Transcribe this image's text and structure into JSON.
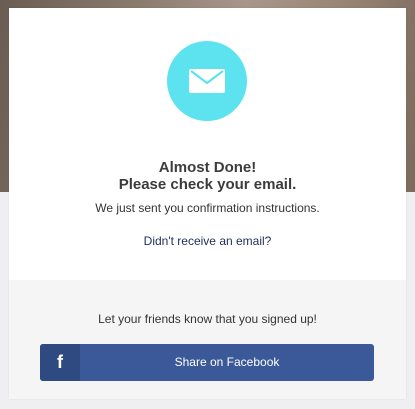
{
  "confirmation": {
    "heading_line1": "Almost Done!",
    "heading_line2": "Please check your email.",
    "message": "We just sent you confirmation instructions.",
    "resend_link": "Didn't receive an email?",
    "icon": "envelope-icon",
    "icon_color": "#5ce3ef"
  },
  "share": {
    "prompt": "Let your friends know that you signed up!",
    "facebook_icon_glyph": "f",
    "facebook_button_label": "Share on Facebook",
    "facebook_color": "#3b5998"
  }
}
